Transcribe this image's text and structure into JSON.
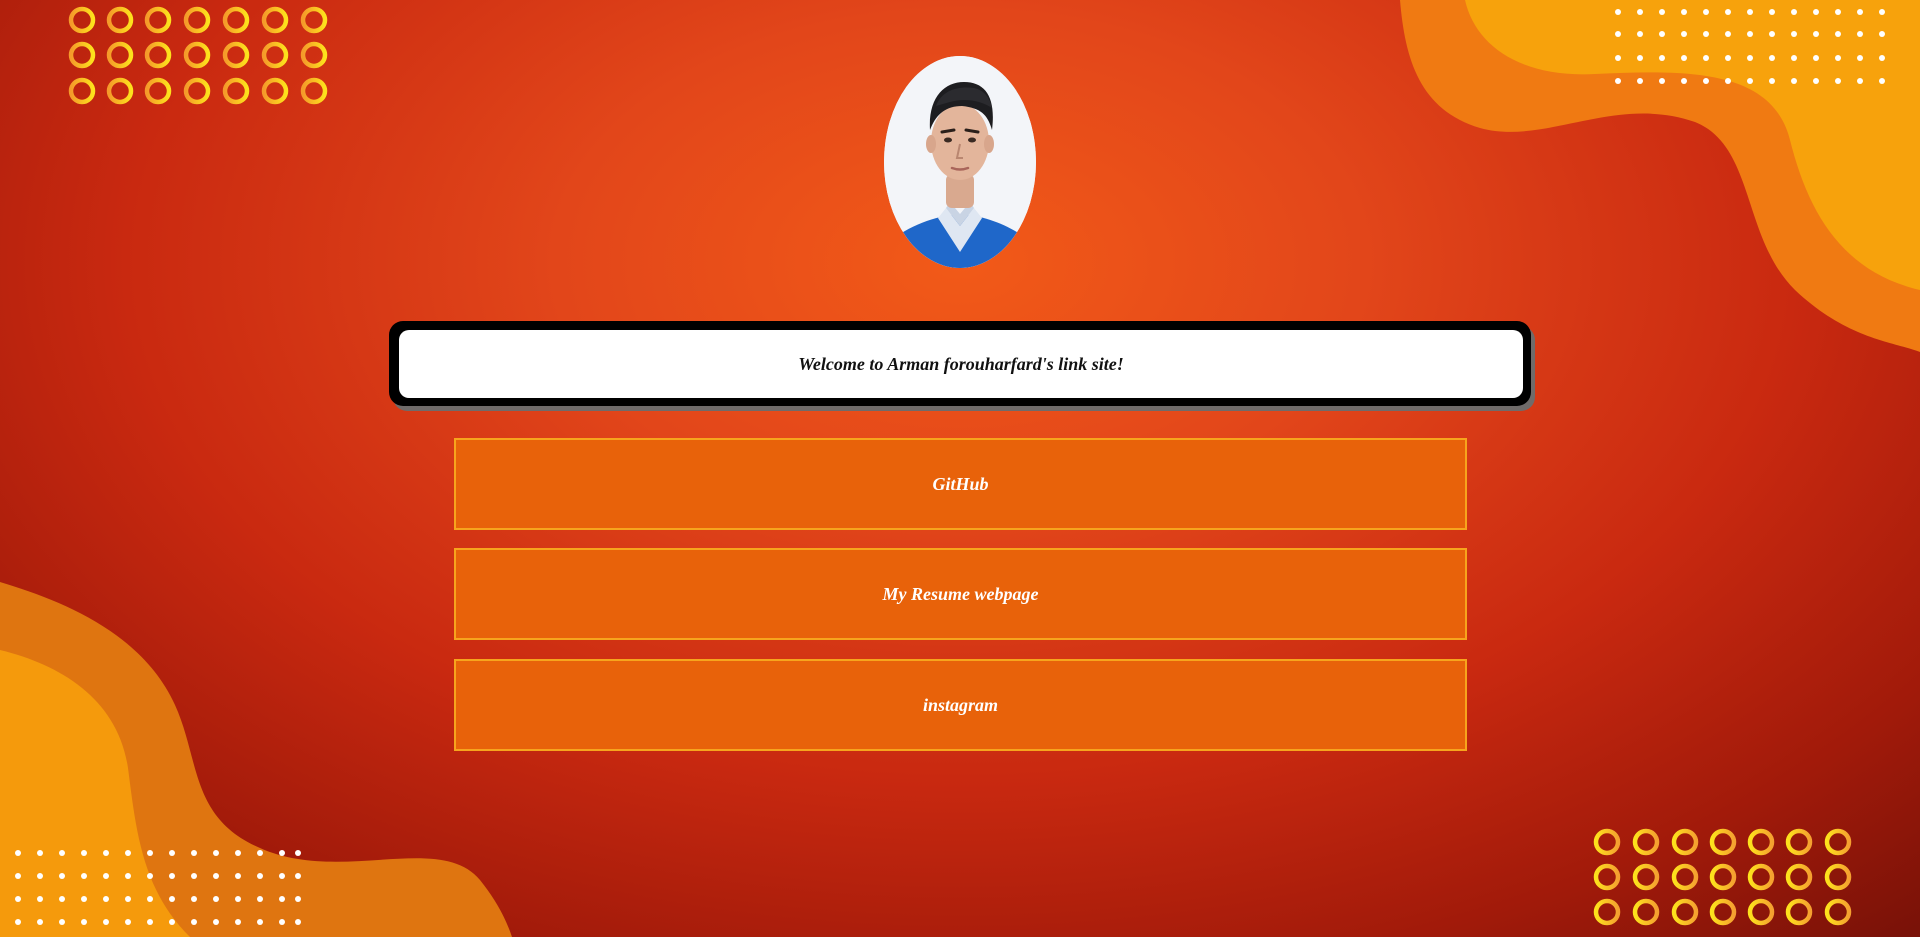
{
  "profile": {
    "avatar": "profile-photo"
  },
  "welcome": {
    "text": "Welcome to Arman forouharfard's link site!"
  },
  "links": [
    {
      "label": "GitHub"
    },
    {
      "label": "My Resume webpage"
    },
    {
      "label": "instagram"
    }
  ],
  "colors": {
    "background_top": "#f25a18",
    "background_bottom": "#a11a0a",
    "wave": "#f59a0c",
    "button_fill": "#e8620a",
    "button_border": "#f7a41d",
    "ring_yellow": "#fde21c",
    "ring_orange": "#f5a030"
  }
}
